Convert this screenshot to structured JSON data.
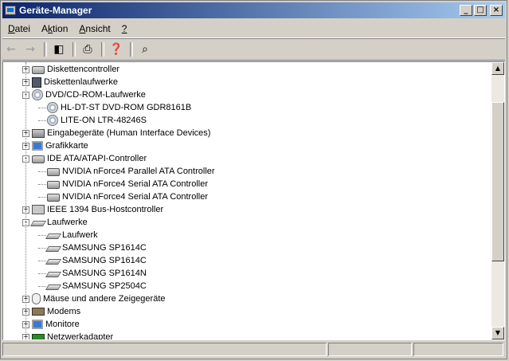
{
  "window": {
    "title": "Geräte-Manager"
  },
  "menu": [
    {
      "pre": "",
      "key": "D",
      "post": "atei"
    },
    {
      "pre": "A",
      "key": "k",
      "post": "tion"
    },
    {
      "pre": "",
      "key": "A",
      "post": "nsicht"
    },
    {
      "pre": "",
      "key": "?",
      "post": ""
    }
  ],
  "tree": [
    {
      "label": "Diskettencontroller",
      "level": 0,
      "toggle": "+",
      "icon": "drive"
    },
    {
      "label": "Diskettenlaufwerke",
      "level": 0,
      "toggle": "+",
      "icon": "floppy"
    },
    {
      "label": "DVD/CD-ROM-Laufwerke",
      "level": 0,
      "toggle": "-",
      "icon": "cd"
    },
    {
      "label": "HL-DT-ST DVD-ROM GDR8161B",
      "level": 1,
      "toggle": "",
      "icon": "cd"
    },
    {
      "label": "LITE-ON LTR-48246S",
      "level": 1,
      "toggle": "",
      "icon": "cd"
    },
    {
      "label": "Eingabegeräte (Human Interface Devices)",
      "level": 0,
      "toggle": "+",
      "icon": "hid"
    },
    {
      "label": "Grafikkarte",
      "level": 0,
      "toggle": "+",
      "icon": "display"
    },
    {
      "label": "IDE ATA/ATAPI-Controller",
      "level": 0,
      "toggle": "-",
      "icon": "drive"
    },
    {
      "label": "NVIDIA nForce4 Parallel ATA Controller",
      "level": 1,
      "toggle": "",
      "icon": "drive"
    },
    {
      "label": "NVIDIA nForce4 Serial ATA Controller",
      "level": 1,
      "toggle": "",
      "icon": "drive"
    },
    {
      "label": "NVIDIA nForce4 Serial ATA Controller",
      "level": 1,
      "toggle": "",
      "icon": "drive"
    },
    {
      "label": "IEEE 1394 Bus-Hostcontroller",
      "level": 0,
      "toggle": "+",
      "icon": "chip"
    },
    {
      "label": "Laufwerke",
      "level": 0,
      "toggle": "-",
      "icon": "hdd"
    },
    {
      "label": "Laufwerk",
      "level": 1,
      "toggle": "",
      "icon": "hdd"
    },
    {
      "label": "SAMSUNG SP1614C",
      "level": 1,
      "toggle": "",
      "icon": "hdd"
    },
    {
      "label": "SAMSUNG SP1614C",
      "level": 1,
      "toggle": "",
      "icon": "hdd"
    },
    {
      "label": "SAMSUNG SP1614N",
      "level": 1,
      "toggle": "",
      "icon": "hdd"
    },
    {
      "label": "SAMSUNG SP2504C",
      "level": 1,
      "toggle": "",
      "icon": "hdd"
    },
    {
      "label": "Mäuse und andere Zeigegeräte",
      "level": 0,
      "toggle": "+",
      "icon": "mouse"
    },
    {
      "label": "Modems",
      "level": 0,
      "toggle": "+",
      "icon": "modem"
    },
    {
      "label": "Monitore",
      "level": 0,
      "toggle": "+",
      "icon": "display"
    },
    {
      "label": "Netzwerkadapter",
      "level": 0,
      "toggle": "+",
      "icon": "board"
    }
  ],
  "toolbar_icons": [
    "back-arrow-icon",
    "forward-arrow-icon",
    "show-hide-tree-icon",
    "print-icon",
    "properties-help-icon",
    "scan-hardware-icon"
  ]
}
